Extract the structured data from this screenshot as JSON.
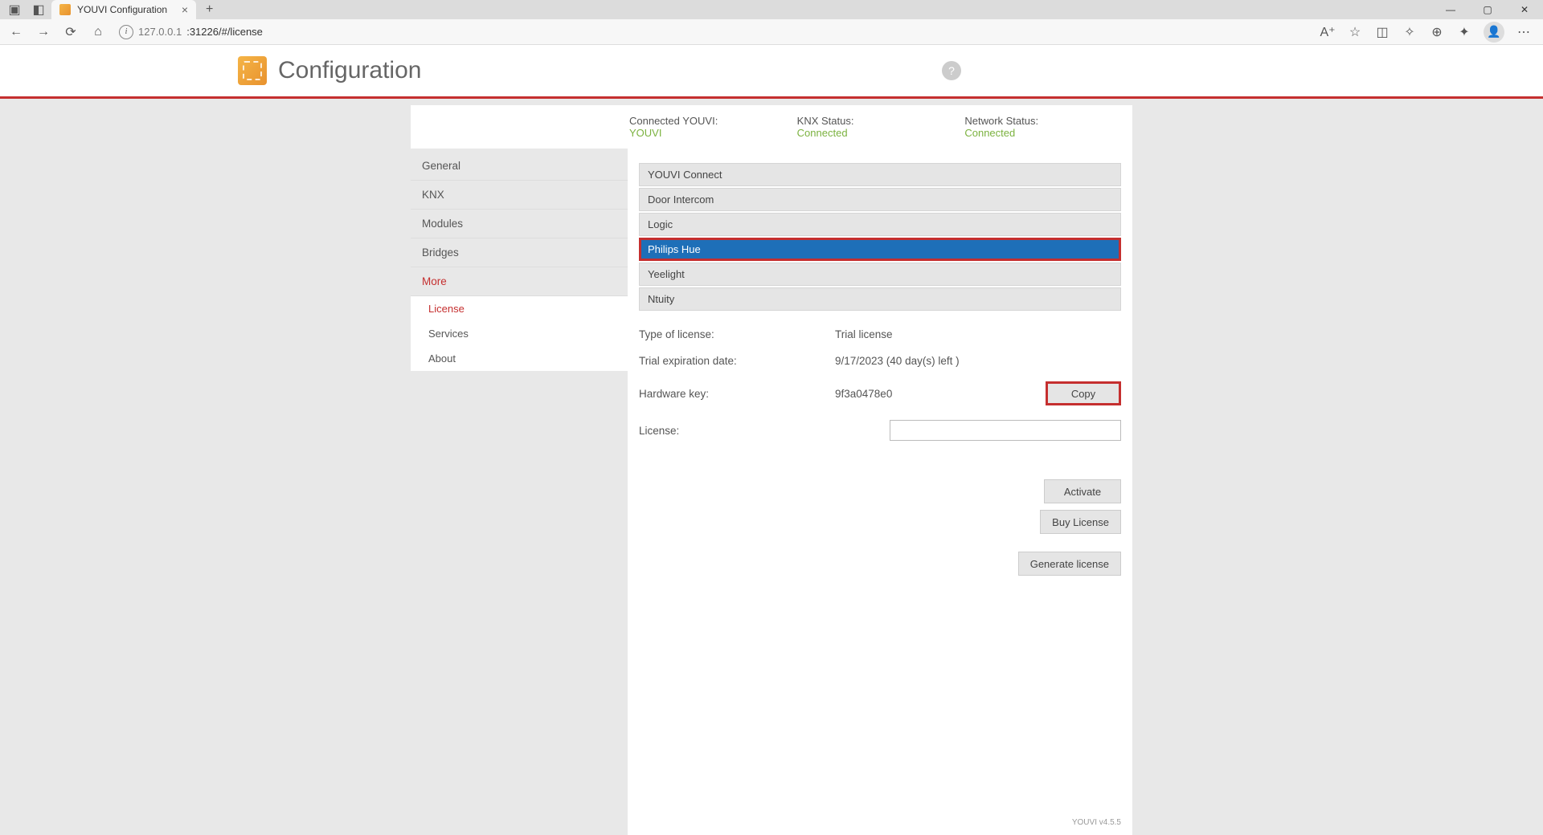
{
  "browser": {
    "tab_title": "YOUVI Configuration",
    "url_host": "127.0.0.1",
    "url_port_path": ":31226/#/license"
  },
  "header": {
    "title": "Configuration"
  },
  "status": {
    "connected_label": "Connected YOUVI:",
    "connected_value": "YOUVI",
    "knx_label": "KNX Status:",
    "knx_value": "Connected",
    "net_label": "Network Status:",
    "net_value": "Connected"
  },
  "sidebar": {
    "items": [
      "General",
      "KNX",
      "Modules",
      "Bridges",
      "More"
    ],
    "sub_items": [
      "License",
      "Services",
      "About"
    ]
  },
  "modules": [
    "YOUVI Connect",
    "Door Intercom",
    "Logic",
    "Philips Hue",
    "Yeelight",
    "Ntuity"
  ],
  "license": {
    "type_label": "Type of license:",
    "type_value": "Trial license",
    "exp_label": "Trial expiration date:",
    "exp_value": "9/17/2023 (40 day(s) left )",
    "hw_label": "Hardware key:",
    "hw_value": "9f3a0478e0",
    "copy": "Copy",
    "lic_label": "License:",
    "activate": "Activate",
    "buy": "Buy License",
    "generate": "Generate license"
  },
  "footer": "YOUVI v4.5.5"
}
